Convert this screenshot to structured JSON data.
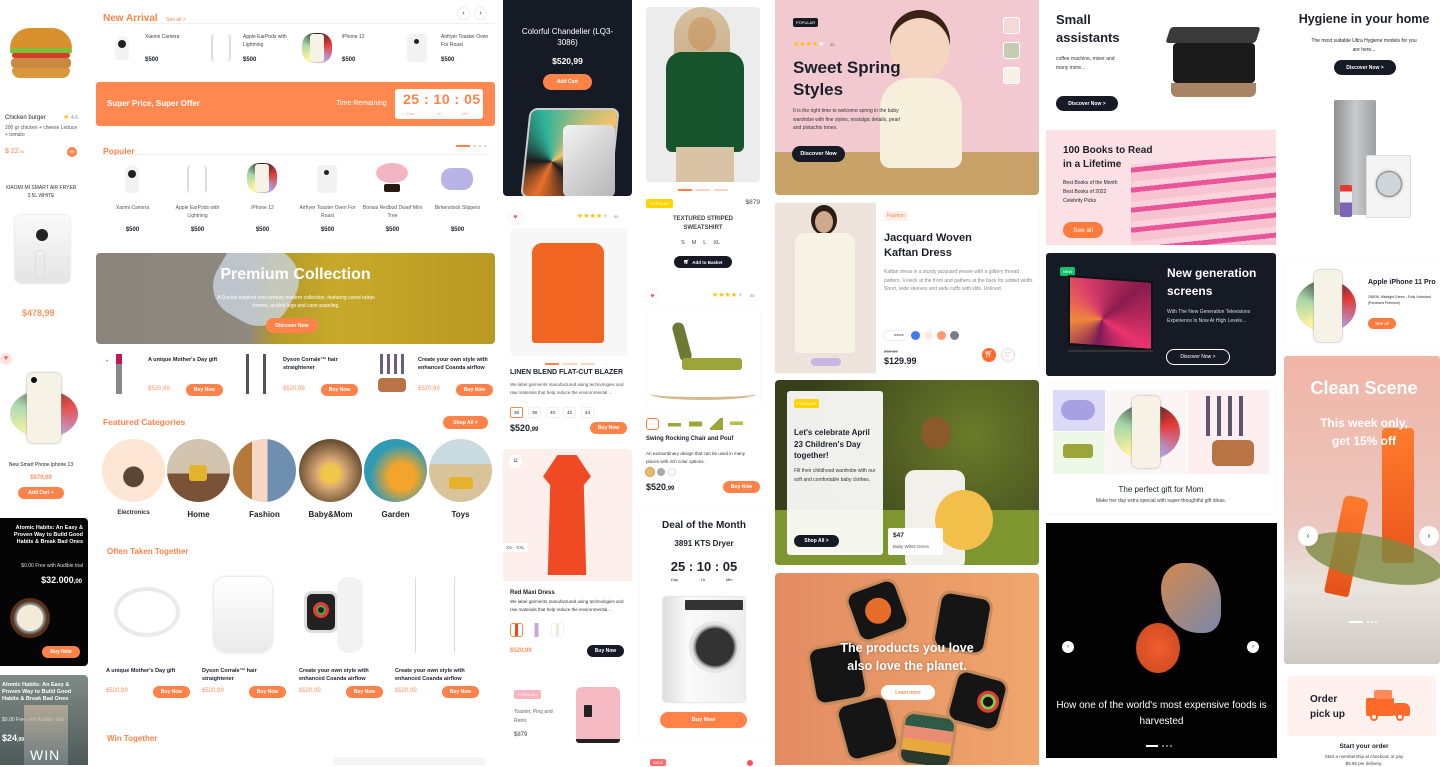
{
  "left": {
    "burger": {
      "name": "Chicken burger",
      "rating": "4.6",
      "desc": "200 gr chicken + cheese Lettuce + tomato",
      "price": "$ 22",
      "cents": ",00"
    },
    "fryer": {
      "name": "XIAOMI MI SMART AIR FRYER 3.5L WHITE",
      "price": "$478,99"
    },
    "iphone": {
      "name": "New Smart Phone Iphone 13",
      "price": "$879,09",
      "button": "Add Cart +"
    },
    "book1": {
      "title": "Atomic Habits: An Easy & Proven Way to Build Good Habits & Break Bad Ones",
      "sub": "$0.00 Free with Audible trial",
      "price": "$32.000",
      "cents": ",00",
      "button": "Buy Now"
    },
    "book2": {
      "title": "Atomic Habits: An Easy & Proven Way to Build Good Habits & Break Bad Ones",
      "sub": "$0.00 Free with Audible trial",
      "price": "$24",
      "cents": ",99",
      "cover": "WIN"
    }
  },
  "col2": {
    "new_arrival": {
      "title": "New Arrival",
      "see_all": "See all >",
      "items": [
        {
          "name": "Xiaomi Camera",
          "price": "$500"
        },
        {
          "name": "Apple EarPods with Lightning",
          "price": "$500"
        },
        {
          "name": "iPhone 12",
          "price": "$500"
        },
        {
          "name": "Airfryer Toaster Oven For Roast",
          "price": "$500"
        }
      ]
    },
    "super": {
      "title": "Super Price, Super Offer",
      "remaining": "Time Remaining",
      "d": "25",
      "h": "10",
      "m": "05",
      "dl": "Day",
      "hl": "Hr",
      "ml": "Min"
    },
    "populer": {
      "title": "Populer",
      "items": [
        {
          "name": "Xaomi Camera",
          "price": "$500"
        },
        {
          "name": "Apple EarPods with Lightning",
          "price": "$500"
        },
        {
          "name": "iPhone 12",
          "price": "$500"
        },
        {
          "name": "Airfryer Toaster Oven For Roast",
          "price": "$500"
        },
        {
          "name": "Bonsai Redbud Dwarf Mini Tree",
          "price": "$500"
        },
        {
          "name": "Birkenstock Slippers",
          "price": "$500"
        }
      ]
    },
    "premium": {
      "title": "Premium Collection",
      "desc": "A Danish-inspired mid-century modern collection, featuring cured rattan frames, angled legs and cane paneling.",
      "button": "Discover Now"
    },
    "deals": [
      {
        "name": "A unique Mother's Day gift",
        "price": "$520,99",
        "button": "Buy Now"
      },
      {
        "name": "Dyson Corrale™ hair straightener",
        "price": "$520,99",
        "button": "Buy Now"
      },
      {
        "name": "Create your own style with enhanced Coanda airflow",
        "price": "$520,99",
        "button": "Buy Now"
      }
    ],
    "featured": {
      "title": "Featured Categories",
      "button": "Shop All >",
      "cats": [
        "Electronics",
        "Home",
        "Fashion",
        "Baby&Mom",
        "Garden",
        "Toys"
      ]
    },
    "often": {
      "title": "Often Taken Together",
      "items": [
        {
          "name": "A unique Mother's Day gift",
          "price": "$520,99",
          "button": "Buy Now"
        },
        {
          "name": "Dyson Corrale™ hair straightener",
          "price": "$520,99",
          "button": "Buy Now"
        },
        {
          "name": "Create your own style with enhanced Coanda airflow",
          "price": "$520,99",
          "button": "Buy Now"
        },
        {
          "name": "Create your own style with enhanced Coanda airflow",
          "price": "$520,99",
          "button": "Buy Now"
        }
      ]
    },
    "win": {
      "title": "Win Together"
    }
  },
  "col3": {
    "chandelier": {
      "title": "Colorful Chandelier (LQ3-3086)",
      "price": "$520,99",
      "button": "Add Cart"
    },
    "blazer": {
      "reviews": "55",
      "name": "LINEN BLEND FLAT-CUT BLAZER",
      "desc": "We label garments manufactured using technologies and raw materials that help reduce the environmental ...",
      "sizes": [
        "36",
        "38",
        "40",
        "42",
        "44"
      ],
      "price": "$520",
      "cents": ",99",
      "button": "Buy Now"
    },
    "dress": {
      "size": "XS - XXL",
      "name": "Red Maxi Dress",
      "desc": "We label garments manufactured using technologies and raw materials that help reduce the environmental...",
      "price": "$520,99",
      "button": "Buy Now"
    },
    "toaster": {
      "badge": "POPULAR",
      "name": "Toaster, Ping and Retro",
      "price": "$879"
    }
  },
  "col4": {
    "sweat": {
      "badge": "POPULAR",
      "price": "$879",
      "name": "TEXTURED STRIPED SWEATSHIRT",
      "sizes": [
        "S",
        "M",
        "L",
        "XL"
      ],
      "button": "Add to Basket"
    },
    "chair": {
      "reviews": "55",
      "name": "Swing Rocking Chair and Pouf",
      "desc": "An extraordinary design that can be used in many places with rich color options.",
      "price": "$520",
      "cents": ",99",
      "button": "Buy Now"
    },
    "deal": {
      "title": "Deal of the Month",
      "product": "3891 KTS Dryer",
      "d": "25",
      "h": "10",
      "m": "05",
      "dl": "Day",
      "hl": "Hr",
      "ml": "Min",
      "button": "Buy Now"
    },
    "sale": {
      "badge": "SALE"
    }
  },
  "col5": {
    "spring": {
      "badge": "POPULAR",
      "reviews": "95",
      "title": "Sweet Spring Styles",
      "desc": "It is the right time to welcome spring in the baby wardrobe with fine styles, nostalgic details, pearl and pistachio tones.",
      "button": "Discover Now"
    },
    "kaftan": {
      "tag": "Fashion",
      "title": "Jacquard Woven Kaftan Dress",
      "desc": "Kaftan dress in a sturdy jacquard weave with a glittery thread pattern. V-neck at the front and gathers at the back for added width. Short, wide sleeves and wide cuffs with slits. Unlined.",
      "swatch_label": "WHITE",
      "old_price": "$69.99",
      "price": "$129.99"
    },
    "children": {
      "badge": "POPULAR",
      "title": "Let's celebrate April 23 Children's Day together!",
      "desc": "Fill their childhood wardrobe with our soft and comfortable baby clothes.",
      "button": "Shop All >",
      "price": "$47",
      "product": "Baby White Dress"
    },
    "planet": {
      "title": "The products you love also love the planet.",
      "button": "Learn more"
    }
  },
  "col6": {
    "small": {
      "title": "Small assistants",
      "desc": "coffee machine, mixer and many more...",
      "button": "Discover Now >"
    },
    "books": {
      "title": "100 Books to Read in a Lifetime",
      "lines": [
        "Best Books of the Month",
        "Best Books of 2022",
        "Celebrity Picks"
      ],
      "button": "See all"
    },
    "screens": {
      "badge": "NEW",
      "title": "New generation screens",
      "desc": "With The New Generation Televisions Experience Is Now At High Levels...",
      "button": "Discover Now >"
    },
    "gift": {
      "title": "The perfect gift for Mom",
      "desc": "Make her day extra special with super-thoughtful gift ideas."
    },
    "fish": {
      "title": "How one of the world's most expensive foods is harvested"
    }
  },
  "col7": {
    "hygiene": {
      "title": "Hygiene in your home",
      "desc": "The most suitable Ultra Hygiene models for you are here...",
      "button": "Discover Now >"
    },
    "iphone": {
      "title": "Apple iPhone 11 Pro",
      "desc": "256GB, Midnight Green - Fully Unlocked (Renewed Premium)",
      "button": "See all"
    },
    "clean": {
      "title": "Clean Scene",
      "sub": "This week only, get 15% off"
    },
    "order": {
      "title": "Order pick up",
      "sub_title": "Start your order",
      "sub": "Start a membership at checkout, or pay $9.99 per delivery."
    }
  },
  "colors": {
    "accent": "#ff8349",
    "dark": "#161a24",
    "popular": "#ffd400",
    "new": "#11c26d"
  }
}
